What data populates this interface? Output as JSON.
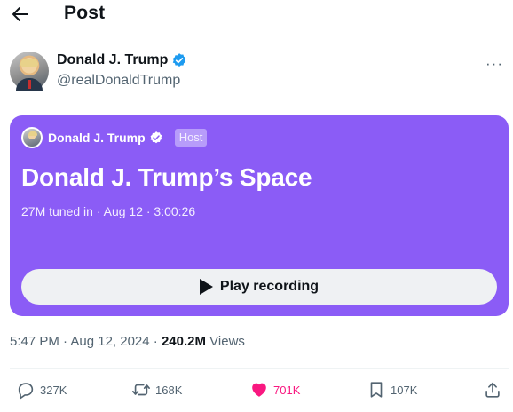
{
  "header": {
    "title": "Post"
  },
  "author": {
    "name": "Donald J. Trump",
    "handle": "@realDonaldTrump"
  },
  "space": {
    "host_name": "Donald J. Trump",
    "host_badge": "Host",
    "title": "Donald J. Trump’s Space",
    "meta": "27M tuned in · Aug 12 · 3:00:26",
    "play_label": "Play recording",
    "color": "#8b5cf6"
  },
  "post": {
    "time": "5:47 PM · Aug 12, 2024 · ",
    "views_count": "240.2M",
    "views_label": " Views"
  },
  "actions": {
    "replies": "327K",
    "reposts": "168K",
    "likes": "701K",
    "bookmarks": "107K",
    "like_color": "#f91880"
  },
  "icons": [
    "back-arrow-icon",
    "verified-badge-icon",
    "more-icon",
    "play-icon",
    "reply-icon",
    "repost-icon",
    "heart-icon",
    "bookmark-icon",
    "share-icon"
  ]
}
